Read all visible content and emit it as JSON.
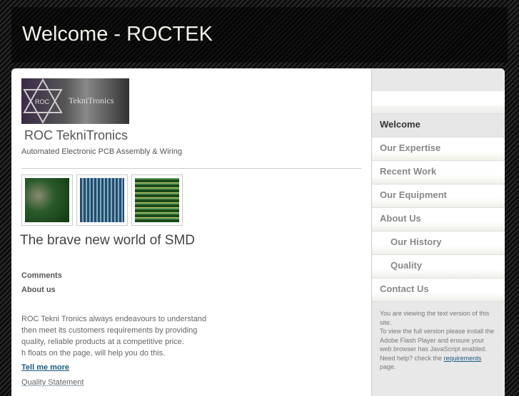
{
  "header": {
    "title": "Welcome - ROCTEK"
  },
  "logo": {
    "text": "ROC TekniTronics"
  },
  "site": {
    "name": "ROC TekniTronics",
    "tagline": "Automated Electronic PCB Assembly & Wiring"
  },
  "main": {
    "heading": "The brave new world of SMD",
    "comments": "Comments",
    "about": "About us",
    "body": [
      "ROC Tekni Tronics always endeavours to understand",
      "then meet its customers requirements by providing",
      "quality, reliable products at a competitive price.",
      "h floats on the page, will help you do this."
    ],
    "tell_more": "Tell me more",
    "quality": "Quality Statement"
  },
  "nav": [
    {
      "label": "Welcome"
    },
    {
      "label": "Our Expertise"
    },
    {
      "label": "Recent Work"
    },
    {
      "label": "Our Equipment"
    },
    {
      "label": "About Us"
    },
    {
      "label": "Our History"
    },
    {
      "label": "Quality"
    },
    {
      "label": "Contact Us"
    }
  ],
  "info": {
    "l1": "You are viewing the text version of this site.",
    "l2": "To view the full version please install the Adobe Flash Player and ensure your web browser has JavaScript enabled.",
    "l3": "Need help? check the",
    "link": "requirements",
    "l4": "page."
  }
}
